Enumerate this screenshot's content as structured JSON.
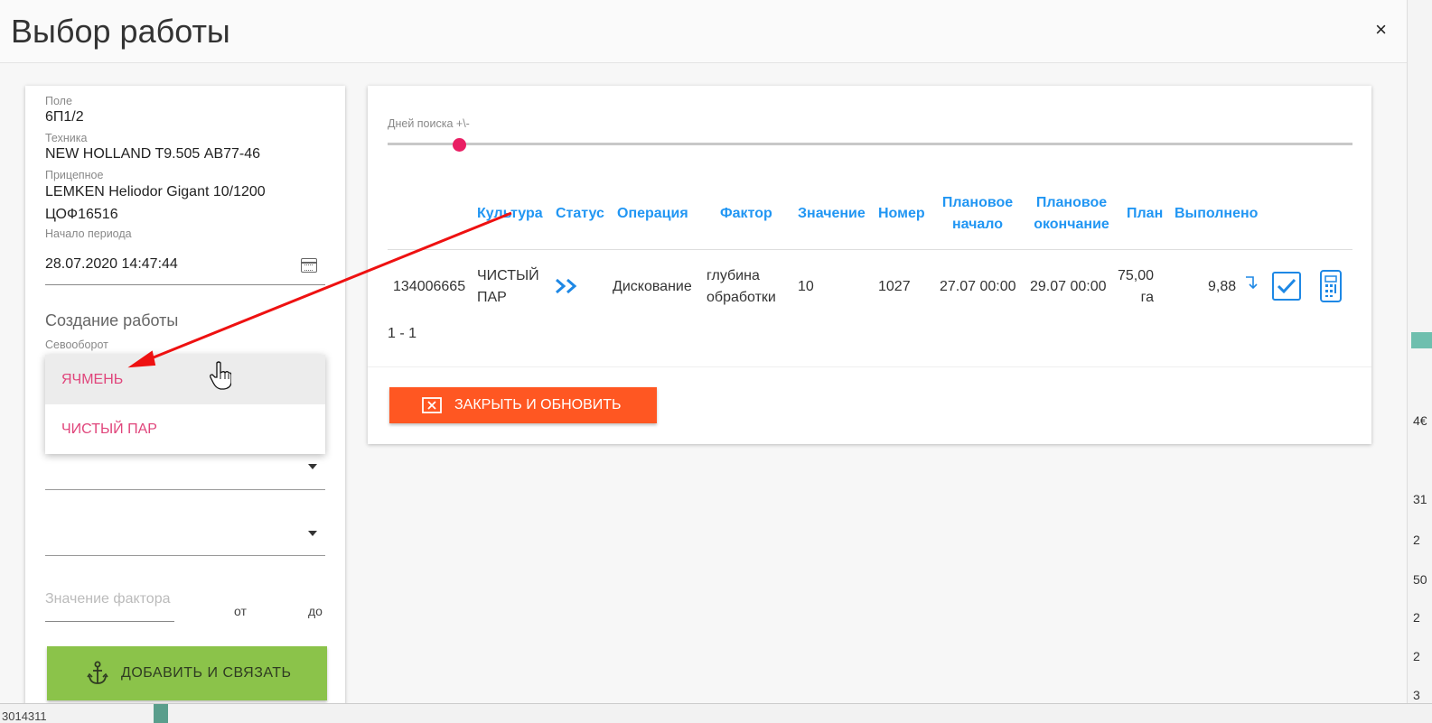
{
  "modal": {
    "title": "Выбор работы",
    "close_glyph": "×"
  },
  "left": {
    "field_label": "Поле",
    "field_value": "6П1/2",
    "machine_label": "Техника",
    "machine_value": "NEW HOLLAND T9.505 АВ77-46",
    "trailer_label": "Прицепное",
    "trailer_value_line1": "LEMKEN Heliodor Gigant 10/1200",
    "trailer_value_line2": "ЦОФ16516",
    "period_label": "Начало периода",
    "period_value": "28.07.2020 14:47:44",
    "create_title": "Создание работы",
    "rotation_label": "Севооборот",
    "rotation_options": [
      "ЯЧМЕНЬ",
      "ЧИСТЫЙ ПАР"
    ],
    "factor_placeholder": "Значение фактора",
    "from_label": "от",
    "to_label": "до",
    "add_button": "ДОБАВИТЬ И СВЯЗАТЬ"
  },
  "right": {
    "slider_label": "Дней поиска +\\-",
    "slider_value_fraction": 0.07,
    "columns": [
      "Культура",
      "Статус",
      "Операция",
      "Фактор",
      "Значение",
      "Номер",
      "Плановое начало",
      "Плановое окончание",
      "План",
      "Выполнено"
    ],
    "columns_split": {
      "plan_start_1": "Плановое",
      "plan_start_2": "начало",
      "plan_end_1": "Плановое",
      "plan_end_2": "окончание"
    },
    "row": {
      "id": "134006665",
      "culture_1": "ЧИСТЫЙ",
      "culture_2": "ПАР",
      "operation": "Дискование",
      "factor_1": "глубина",
      "factor_2": "обработки",
      "value": "10",
      "number": "1027",
      "plan_start": "27.07 00:00",
      "plan_end": "29.07 00:00",
      "plan_1": "75,00",
      "plan_2": "га",
      "done": "9,88"
    },
    "pager": "1 - 1",
    "close_button": "ЗАКРЫТЬ И ОБНОВИТЬ"
  },
  "background": {
    "right_strip": [
      "4€",
      "31",
      "2",
      "50",
      "2",
      "2",
      "3"
    ],
    "bottom_text": "3014311"
  },
  "colors": {
    "accent_blue": "#2196f3",
    "pink": "#e0457b",
    "green_button": "#8bc34a",
    "orange_button": "#ff5722",
    "annotation_arrow": "#ee1111"
  }
}
